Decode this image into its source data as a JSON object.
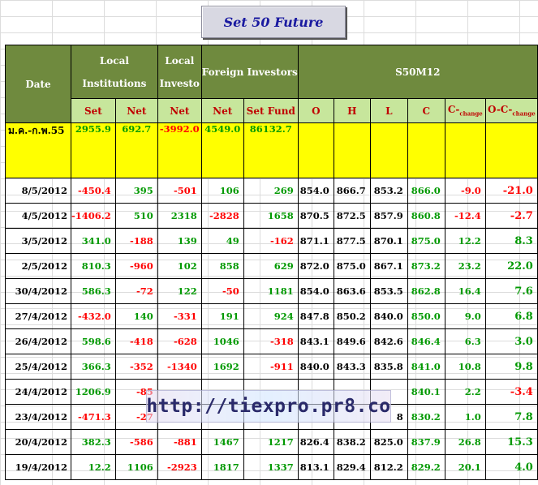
{
  "title": "Set 50  Future",
  "headers": {
    "date": "Date",
    "local_institutions_line1": "Local",
    "local_institutions_line2": "Institutions",
    "local_investo_line1": "Local",
    "local_investo_line2": "Investo",
    "foreign_investors": "Foreign Investors",
    "contract": "S50M12",
    "sub": [
      "Set",
      "Net",
      "Net",
      "Net",
      "Set Fund",
      "O",
      "H",
      "L",
      "C"
    ],
    "c_change_main": "C-",
    "c_change_sub": "change",
    "oc_change_main": "O-C-",
    "oc_change_sub": "change"
  },
  "summary": {
    "label": "ม.ค.-ก.พ.55",
    "values": [
      "2955.9",
      "692.7",
      "-3992.0",
      "4549.0",
      "86132.7"
    ]
  },
  "rows": [
    {
      "date": "8/5/2012",
      "cells": [
        "-450.4",
        "395",
        "-501",
        "106",
        "269",
        "854.0",
        "866.7",
        "853.2",
        "866.0",
        "-9.0",
        "-21.0"
      ]
    },
    {
      "date": "4/5/2012",
      "cells": [
        "-1406.2",
        "510",
        "2318",
        "-2828",
        "1658",
        "870.5",
        "872.5",
        "857.9",
        "860.8",
        "-12.4",
        "-2.7"
      ]
    },
    {
      "date": "3/5/2012",
      "cells": [
        "341.0",
        "-188",
        "139",
        "49",
        "-162",
        "871.1",
        "877.5",
        "870.1",
        "875.0",
        "12.2",
        "8.3"
      ]
    },
    {
      "date": "2/5/2012",
      "cells": [
        "810.3",
        "-960",
        "102",
        "858",
        "629",
        "872.0",
        "875.0",
        "867.1",
        "873.2",
        "23.2",
        "22.0"
      ]
    },
    {
      "date": "30/4/2012",
      "cells": [
        "586.3",
        "-72",
        "122",
        "-50",
        "1181",
        "854.0",
        "863.6",
        "853.5",
        "862.8",
        "16.4",
        "7.6"
      ]
    },
    {
      "date": "27/4/2012",
      "cells": [
        "-432.0",
        "140",
        "-331",
        "191",
        "924",
        "847.8",
        "850.2",
        "840.0",
        "850.0",
        "9.0",
        "6.8"
      ]
    },
    {
      "date": "26/4/2012",
      "cells": [
        "598.6",
        "-418",
        "-628",
        "1046",
        "-318",
        "843.1",
        "849.6",
        "842.6",
        "846.4",
        "6.3",
        "3.0"
      ]
    },
    {
      "date": "25/4/2012",
      "cells": [
        "366.3",
        "-352",
        "-1340",
        "1692",
        "-911",
        "840.0",
        "843.3",
        "835.8",
        "841.0",
        "10.8",
        "9.8"
      ]
    },
    {
      "date": "24/4/2012",
      "cells": [
        "1206.9",
        "-85",
        "",
        "",
        "",
        "",
        "",
        "",
        "840.1",
        "2.2",
        "-3.4"
      ]
    },
    {
      "date": "23/4/2012",
      "cells": [
        "-471.3",
        "-27",
        "",
        "",
        "",
        "",
        "",
        "8",
        "830.2",
        "1.0",
        "7.8"
      ]
    },
    {
      "date": "20/4/2012",
      "cells": [
        "382.3",
        "-586",
        "-881",
        "1467",
        "1217",
        "826.4",
        "838.2",
        "825.0",
        "837.9",
        "26.8",
        "15.3"
      ]
    },
    {
      "date": "19/4/2012",
      "cells": [
        "12.2",
        "1106",
        "-2923",
        "1817",
        "1337",
        "813.1",
        "829.4",
        "812.2",
        "829.2",
        "20.1",
        "4.0"
      ]
    }
  ],
  "watermark": "http://tiexpro.pr8.co",
  "colors": {
    "header_dark": "#6f8a3e",
    "header_light": "#c7e69c",
    "summary": "#ffff00",
    "positive": "#009900",
    "negative": "#ff0000"
  }
}
